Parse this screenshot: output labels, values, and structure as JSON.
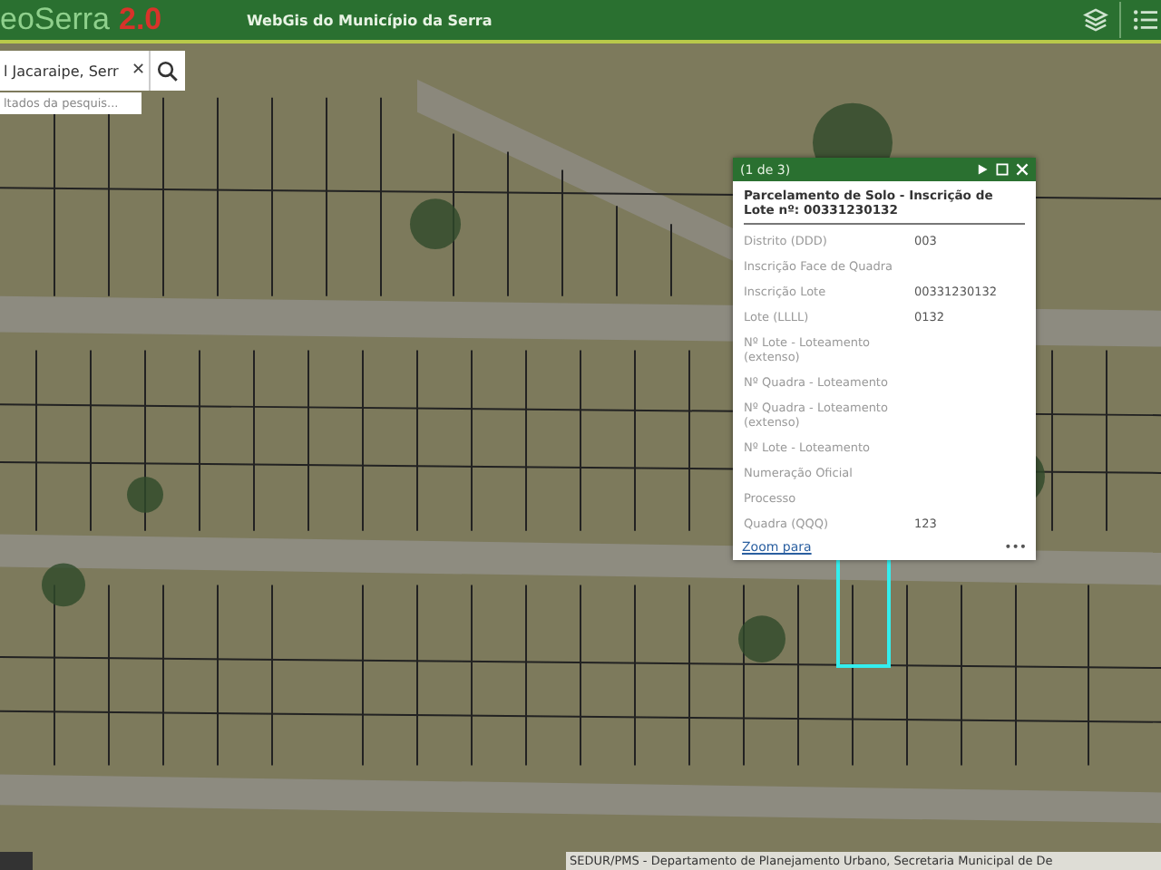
{
  "header": {
    "logo_text": "eoSerra",
    "logo_version": "2.0",
    "title": "WebGis do Município da Serra"
  },
  "search": {
    "value": "l Jacaraipe, Serr",
    "clear": "✕",
    "suggestion": "ltados da pesquis..."
  },
  "popup": {
    "counter": "(1 de 3)",
    "title": "Parcelamento de Solo - Inscrição de Lote nº: 00331230132",
    "fields": [
      {
        "label": "Distrito (DDD)",
        "value": "003"
      },
      {
        "label": "Inscrição Face de Quadra"
      },
      {
        "label": "Inscrição Lote",
        "value": "00331230132"
      },
      {
        "label": "Lote (LLLL)",
        "value": "0132"
      },
      {
        "label": "Nº Lote - Loteamento (extenso)"
      },
      {
        "label": "Nº Quadra - Loteamento"
      },
      {
        "label": "Nº Quadra - Loteamento (extenso)"
      },
      {
        "label": "Nº Lote - Loteamento"
      },
      {
        "label": "Numeração Oficial"
      },
      {
        "label": "Processo"
      },
      {
        "label": "Quadra (QQQ)",
        "value": "123"
      }
    ],
    "zoom_link": "Zoom para",
    "more": "•••"
  },
  "attribution": "SEDUR/PMS - Departamento de Planejamento Urbano, Secretaria Municipal de De"
}
